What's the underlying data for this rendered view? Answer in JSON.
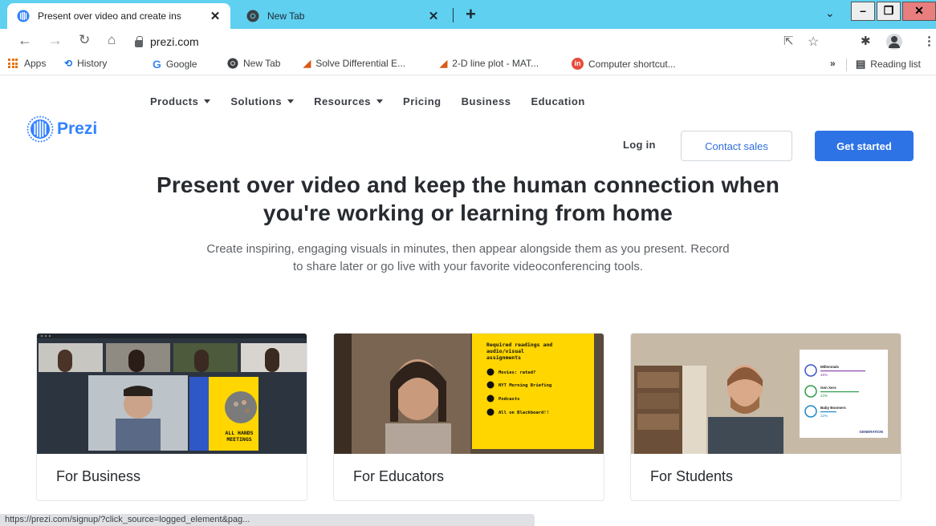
{
  "browser": {
    "tabs": [
      {
        "title": "Present over video and create ins",
        "active": true,
        "icon": "prezi-icon"
      },
      {
        "title": "New Tab",
        "active": false,
        "icon": "chrome-icon"
      }
    ],
    "new_tab_symbol": "+",
    "url": "prezi.com",
    "bookmarks": [
      {
        "label": "Apps",
        "icon": "apps-grid-icon"
      },
      {
        "label": "History",
        "icon": "history-icon"
      },
      {
        "label": "Google",
        "icon": "google-icon"
      },
      {
        "label": "New Tab",
        "icon": "chrome-icon"
      },
      {
        "label": "Solve Differential E...",
        "icon": "matlab-icon"
      },
      {
        "label": "2-D line plot - MAT...",
        "icon": "matlab-icon"
      },
      {
        "label": "Computer shortcut...",
        "icon": "in-icon"
      }
    ],
    "overflow_symbol": "»",
    "reading_list": "Reading list",
    "status_url": "https://prezi.com/signup/?click_source=logged_element&pag..."
  },
  "site": {
    "brand": "Prezi",
    "brand_color": "#3181ff",
    "nav": [
      {
        "label": "Products",
        "dropdown": true
      },
      {
        "label": "Solutions",
        "dropdown": true
      },
      {
        "label": "Resources",
        "dropdown": true
      },
      {
        "label": "Pricing",
        "dropdown": false
      },
      {
        "label": "Business",
        "dropdown": false
      },
      {
        "label": "Education",
        "dropdown": false
      }
    ],
    "login": "Log in",
    "contact_sales": "Contact sales",
    "get_started": "Get started",
    "accent_color": "#2d73e6"
  },
  "hero": {
    "title_line1": "Present over video and keep the human connection when",
    "title_line2": "you're working or learning from home",
    "subtitle": "Create inspiring, engaging visuals in minutes, then appear alongside them as you present. Record to share later or go live with your favorite videoconferencing tools."
  },
  "cards": [
    {
      "label": "For Business",
      "slide_text": [
        "ALL HANDS",
        "MEETINGS"
      ]
    },
    {
      "label": "For Educators",
      "slide_text": [
        "Required readings and",
        "audio/visual",
        "assignments"
      ],
      "slide_items": [
        "Movies: rated?",
        "NYT Morning Briefing",
        "Podcasts",
        "All on Blackboard!!"
      ]
    },
    {
      "label": "For Students",
      "slide_items": [
        {
          "name": "Millennials",
          "pct": "48%"
        },
        {
          "name": "Gen Xers",
          "pct": "43%"
        },
        {
          "name": "Baby Boomers",
          "pct": "12%"
        }
      ],
      "slide_footer": "GENERATION"
    }
  ]
}
